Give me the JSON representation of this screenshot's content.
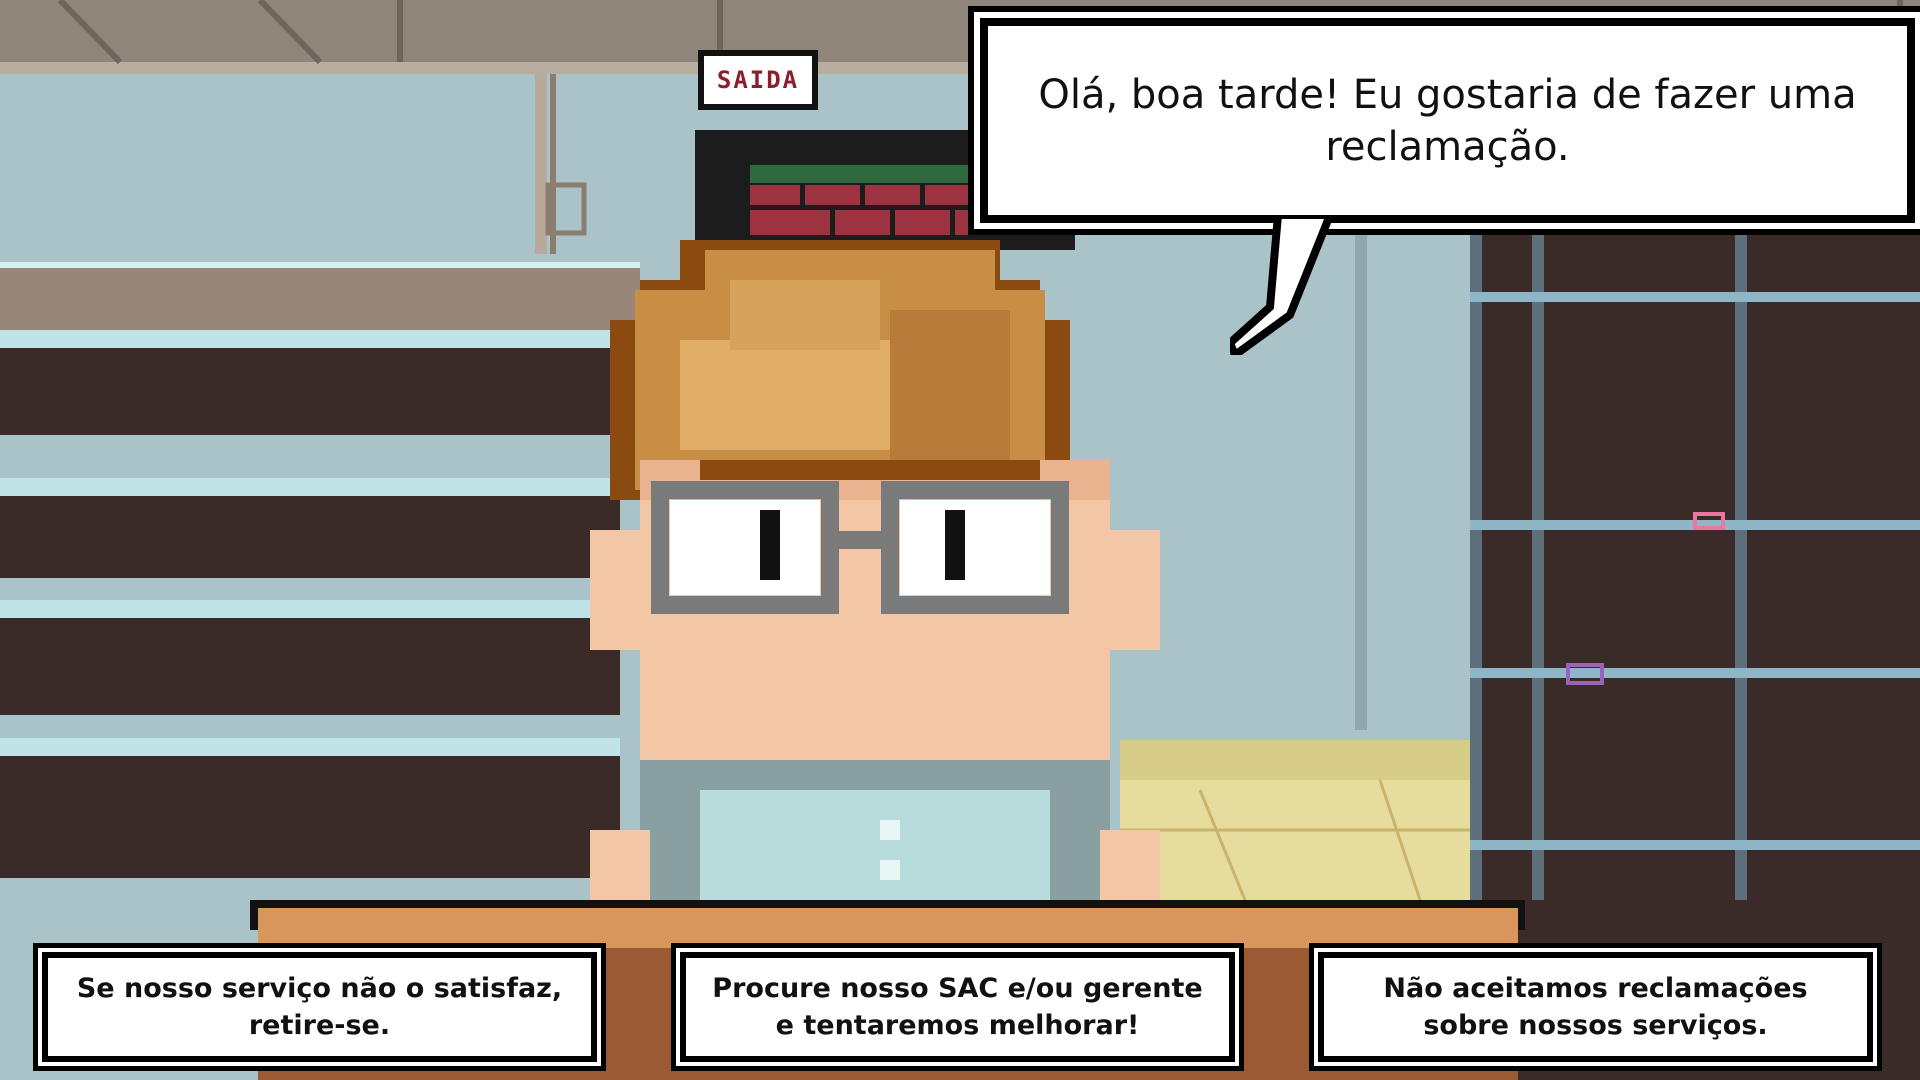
{
  "scene": {
    "exit_sign_text": "SAIDA",
    "colors": {
      "wall": "#a9c3c8",
      "ceiling": "#8f857a",
      "shelf_dark": "#3a2a28",
      "shelf_trim": "#bfe3e6",
      "hair_dark": "#8a4a10",
      "hair_light": "#d6a25c",
      "skin": "#f3c7a5",
      "glasses": "#7a7a7a",
      "shirt": "#b8dcdc",
      "counter": "#d8955c",
      "floor": "#e6dc9e"
    }
  },
  "dialogue": {
    "speaker_line": "Olá, boa tarde! Eu gostaria de fazer uma reclamação."
  },
  "choices": [
    {
      "label": "Se nosso serviço não o satisfaz, retire-se."
    },
    {
      "label": "Procure nosso SAC e/ou gerente e tentaremos melhorar!"
    },
    {
      "label": "Não aceitamos reclamações sobre nossos serviços."
    }
  ]
}
